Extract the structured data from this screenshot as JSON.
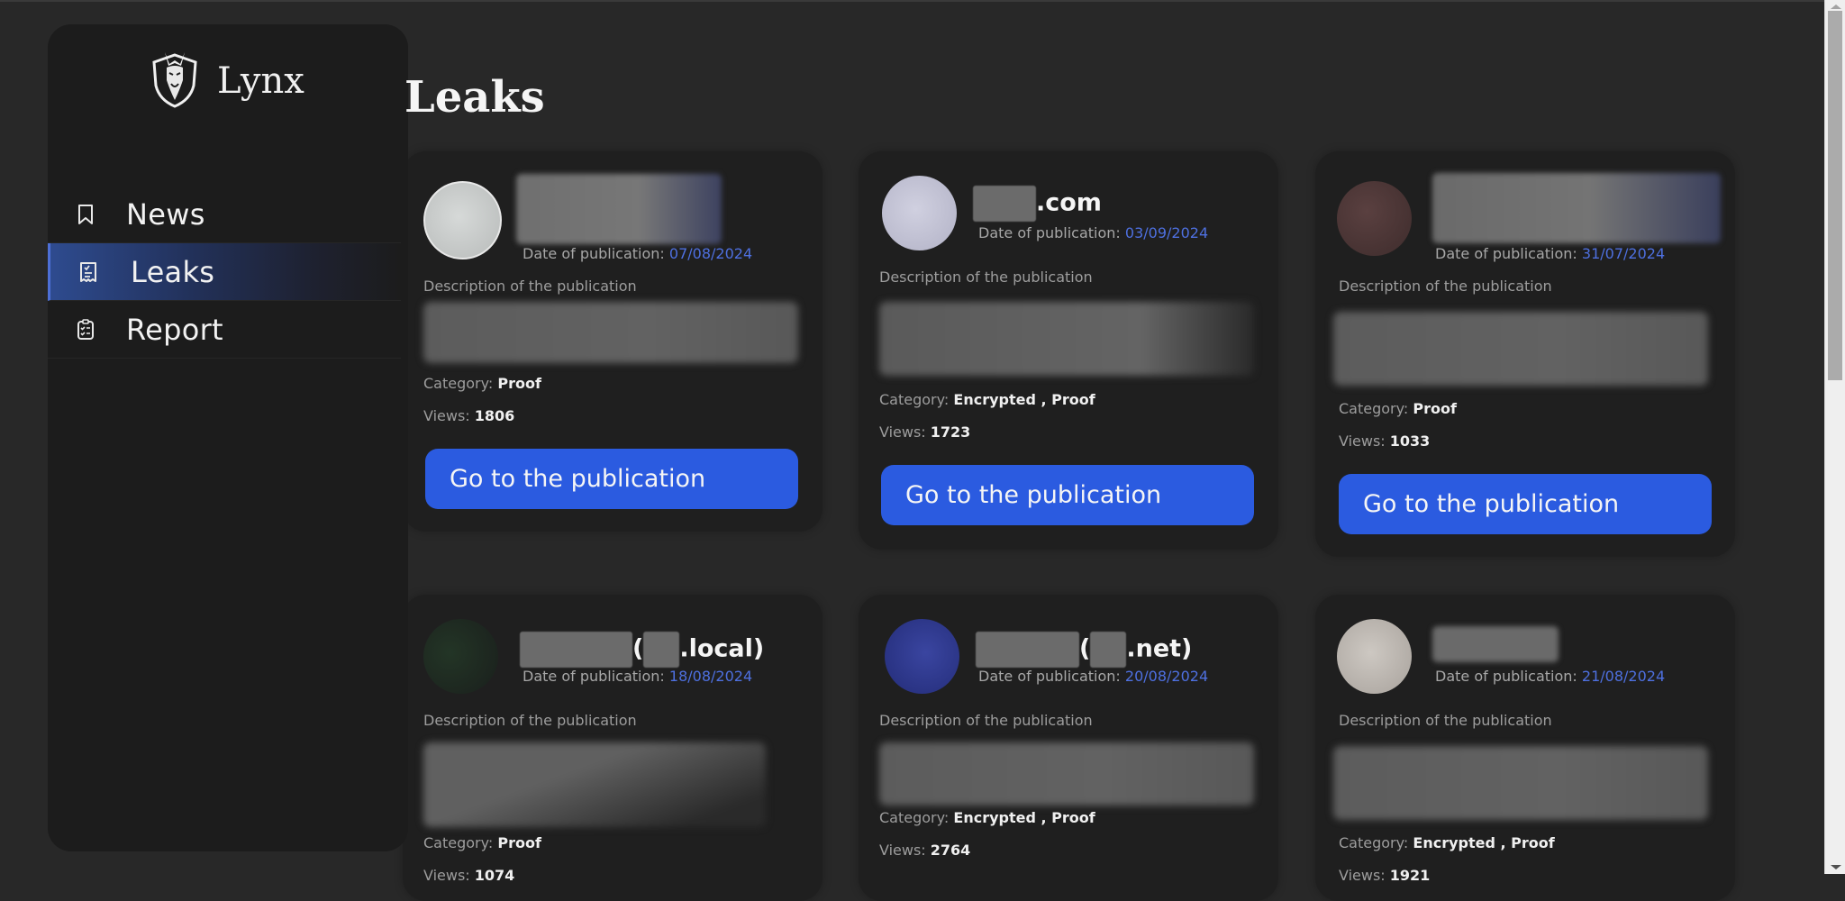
{
  "brand": {
    "name": "Lynx",
    "logo_icon": "lynx-shield-icon"
  },
  "sidebar": {
    "items": [
      {
        "label": "News",
        "icon": "bookmark-icon",
        "active": false
      },
      {
        "label": "Leaks",
        "icon": "receipt-icon",
        "active": true
      },
      {
        "label": "Report",
        "icon": "clipboard-check-icon",
        "active": false
      }
    ]
  },
  "page": {
    "title": "Leaks"
  },
  "labels": {
    "date_prefix": "Date of publication: ",
    "description": "Description of the publication",
    "category_prefix": "Category: ",
    "views_prefix": "Views: ",
    "go_button": "Go to the publication"
  },
  "cards": [
    {
      "title_visible": "",
      "title_redacted": true,
      "date": "07/08/2024",
      "category": "Proof",
      "views": "1806",
      "avatar_color": "#c9cccb"
    },
    {
      "title_visible": ".com",
      "title_redacted": true,
      "date": "03/09/2024",
      "category": "Encrypted , Proof",
      "views": "1723",
      "avatar_color": "#c4c4d6"
    },
    {
      "title_visible": "",
      "title_redacted": true,
      "date": "31/07/2024",
      "category": "Proof",
      "views": "1033",
      "avatar_color": "#4a3434"
    },
    {
      "title_visible": "(.local)",
      "title_redacted": true,
      "date": "18/08/2024",
      "category": "Proof",
      "views": "1074",
      "avatar_color": "#1f2e24"
    },
    {
      "title_visible": "(.net)",
      "title_redacted": true,
      "date": "20/08/2024",
      "category": "Encrypted , Proof",
      "views": "2764",
      "avatar_color": "#2a3588"
    },
    {
      "title_visible": "",
      "title_redacted": true,
      "date": "21/08/2024",
      "category": "Encrypted , Proof",
      "views": "1921",
      "avatar_color": "#bdb7b0"
    }
  ],
  "colors": {
    "accent": "#2b5be0",
    "date": "#4e70e0",
    "background": "#282828",
    "card": "#1f1f1f"
  }
}
